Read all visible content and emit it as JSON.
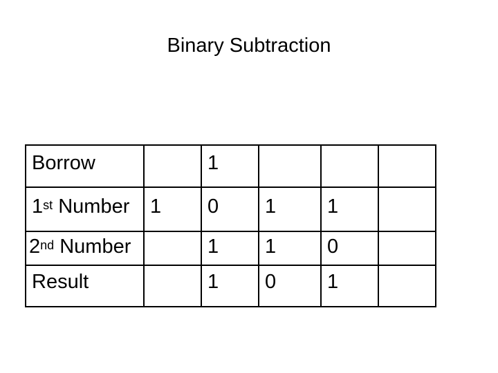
{
  "title": "Binary Subtraction",
  "rows": [
    {
      "label": "Borrow",
      "label_sup": "",
      "label_rest": "",
      "cells": [
        "",
        "1",
        "",
        "",
        ""
      ]
    },
    {
      "label": "1",
      "label_sup": "st",
      "label_rest": " Number",
      "cells": [
        "1",
        "0",
        "1",
        "1",
        ""
      ]
    },
    {
      "label": "2",
      "label_sup": "nd",
      "label_rest": " Number",
      "cells": [
        "",
        "1",
        "1",
        "0",
        ""
      ]
    },
    {
      "label": "Result",
      "label_sup": "",
      "label_rest": "",
      "cells": [
        "",
        "1",
        "0",
        "1",
        ""
      ]
    }
  ]
}
